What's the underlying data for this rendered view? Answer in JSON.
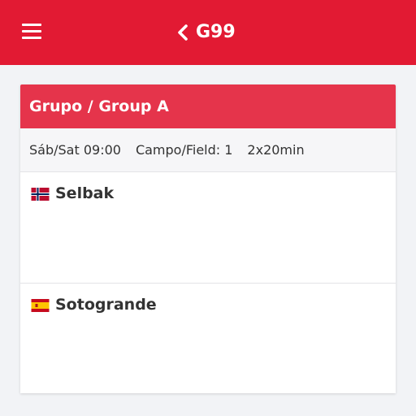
{
  "header": {
    "title": "G99",
    "bg_color": "#e21a33",
    "menu_icon": "hamburger-menu-icon",
    "back_icon": "chevron-left-icon"
  },
  "match_card": {
    "group": "Grupo / Group A",
    "header_color": "#e5344b",
    "day_time": "Sáb/Sat 09:00",
    "field": "Campo/Field: 1",
    "duration": "2x20min",
    "teams": [
      {
        "name": "Selbak",
        "flag_icon": "norway-flag-icon"
      },
      {
        "name": "Sotogrande",
        "flag_icon": "spain-flag-icon"
      }
    ]
  }
}
